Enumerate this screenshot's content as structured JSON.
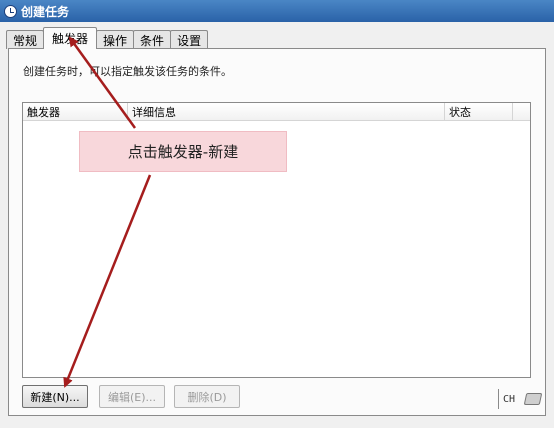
{
  "window": {
    "title": "创建任务"
  },
  "tabs": [
    {
      "label": "常规"
    },
    {
      "label": "触发器"
    },
    {
      "label": "操作"
    },
    {
      "label": "条件"
    },
    {
      "label": "设置"
    }
  ],
  "active_tab": "触发器",
  "description": "创建任务时，可以指定触发该任务的条件。",
  "list": {
    "columns": [
      "触发器",
      "详细信息",
      "状态"
    ],
    "rows": []
  },
  "buttons": {
    "new": "新建(N)...",
    "edit": "编辑(E)...",
    "delete": "删除(D)"
  },
  "annotation": {
    "text": "点击触发器-新建",
    "color": "#a51d1d"
  },
  "ime": {
    "lang": "CH"
  }
}
